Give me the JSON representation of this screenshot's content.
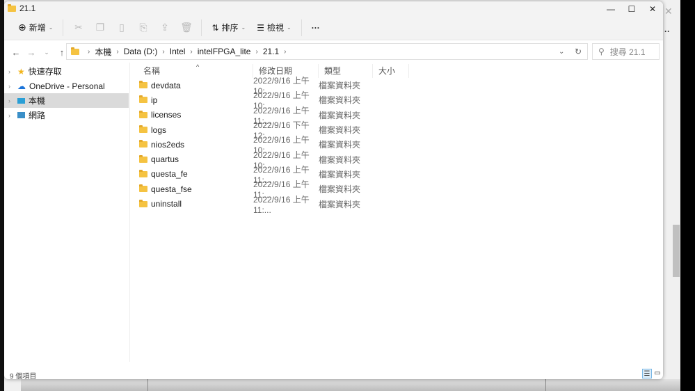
{
  "window": {
    "title": "21.1"
  },
  "toolbar": {
    "new": "新增",
    "sort": "排序",
    "view": "檢視",
    "more": "···"
  },
  "address": {
    "crumbs": [
      "本機",
      "Data (D:)",
      "Intel",
      "intelFPGA_lite",
      "21.1"
    ],
    "search_placeholder": "搜尋 21.1"
  },
  "sidebar": {
    "items": [
      {
        "label": "快速存取"
      },
      {
        "label": "OneDrive - Personal"
      },
      {
        "label": "本機"
      },
      {
        "label": "網路"
      }
    ]
  },
  "columns": {
    "name": "名稱",
    "date": "修改日期",
    "type": "類型",
    "size": "大小"
  },
  "files": [
    {
      "name": "devdata",
      "date": "2022/9/16 上午 10:...",
      "type": "檔案資料夾"
    },
    {
      "name": "ip",
      "date": "2022/9/16 上午 10:...",
      "type": "檔案資料夾"
    },
    {
      "name": "licenses",
      "date": "2022/9/16 上午 11:...",
      "type": "檔案資料夾"
    },
    {
      "name": "logs",
      "date": "2022/9/16 下午 12:...",
      "type": "檔案資料夾"
    },
    {
      "name": "nios2eds",
      "date": "2022/9/16 上午 10:...",
      "type": "檔案資料夾"
    },
    {
      "name": "quartus",
      "date": "2022/9/16 上午 10:...",
      "type": "檔案資料夾"
    },
    {
      "name": "questa_fe",
      "date": "2022/9/16 上午 11:...",
      "type": "檔案資料夾"
    },
    {
      "name": "questa_fse",
      "date": "2022/9/16 上午 11:...",
      "type": "檔案資料夾"
    },
    {
      "name": "uninstall",
      "date": "2022/9/16 上午 11:...",
      "type": "檔案資料夾"
    }
  ],
  "status": {
    "count": "9 個項目"
  }
}
